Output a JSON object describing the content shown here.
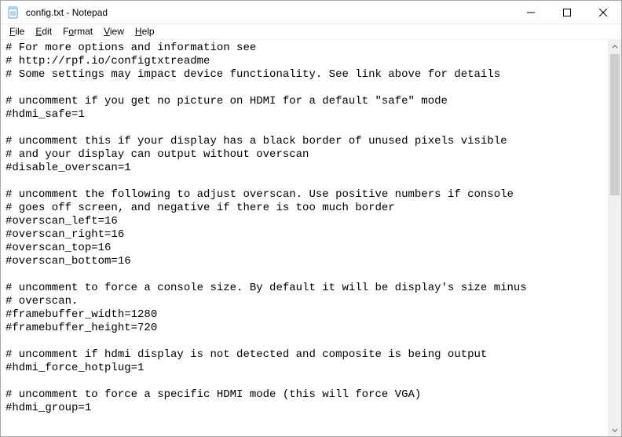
{
  "window": {
    "title": "config.txt - Notepad"
  },
  "menu": {
    "file": "File",
    "edit": "Edit",
    "format": "Format",
    "view": "View",
    "help": "Help"
  },
  "document": {
    "text": "# For more options and information see\n# http://rpf.io/configtxtreadme\n# Some settings may impact device functionality. See link above for details\n\n# uncomment if you get no picture on HDMI for a default \"safe\" mode\n#hdmi_safe=1\n\n# uncomment this if your display has a black border of unused pixels visible\n# and your display can output without overscan\n#disable_overscan=1\n\n# uncomment the following to adjust overscan. Use positive numbers if console\n# goes off screen, and negative if there is too much border\n#overscan_left=16\n#overscan_right=16\n#overscan_top=16\n#overscan_bottom=16\n\n# uncomment to force a console size. By default it will be display's size minus\n# overscan.\n#framebuffer_width=1280\n#framebuffer_height=720\n\n# uncomment if hdmi display is not detected and composite is being output\n#hdmi_force_hotplug=1\n\n# uncomment to force a specific HDMI mode (this will force VGA)\n#hdmi_group=1"
  }
}
